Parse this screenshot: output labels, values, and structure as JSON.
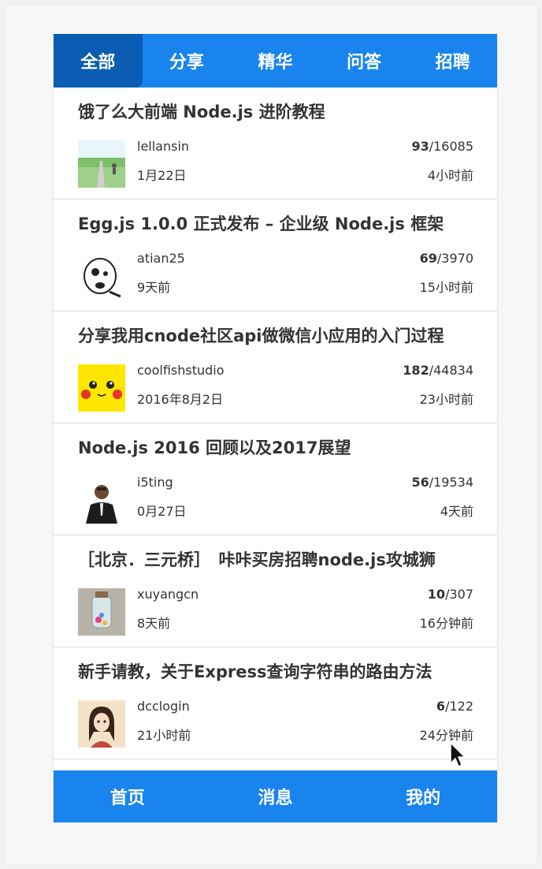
{
  "tabs": [
    "全部",
    "分享",
    "精华",
    "问答",
    "招聘"
  ],
  "topics": [
    {
      "title": "饿了么大前端 Node.js 进阶教程",
      "author": "lellansin",
      "created": "1月22日",
      "replies": "93",
      "visits": "/16085",
      "last_reply": "4小时前"
    },
    {
      "title": "Egg.js 1.0.0 正式发布 – 企业级 Node.js 框架",
      "author": "atian25",
      "created": "9天前",
      "replies": "69",
      "visits": "/3970",
      "last_reply": "15小时前"
    },
    {
      "title": "分享我用cnode社区api做微信小应用的入门过程",
      "author": "coolfishstudio",
      "created": "2016年8月2日",
      "replies": "182",
      "visits": "/44834",
      "last_reply": "23小时前"
    },
    {
      "title": "Node.js 2016 回顾以及2017展望",
      "author": "i5ting",
      "created": "0月27日",
      "replies": "56",
      "visits": "/19534",
      "last_reply": "4天前"
    },
    {
      "title": "［北京．三元桥］　咔咔买房招聘node.js攻城狮",
      "author": "xuyangcn",
      "created": "8天前",
      "replies": "10",
      "visits": "/307",
      "last_reply": "16分钟前"
    },
    {
      "title": "新手请教，关于Express查询字符串的路由方法",
      "author": "dcclogin",
      "created": "21小时前",
      "replies": "6",
      "visits": "/122",
      "last_reply": "24分钟前"
    }
  ],
  "bottom_nav": [
    "首页",
    "消息",
    "我的"
  ],
  "colors": {
    "primary": "#1a84ee",
    "active_tab": "#0b5db4"
  }
}
